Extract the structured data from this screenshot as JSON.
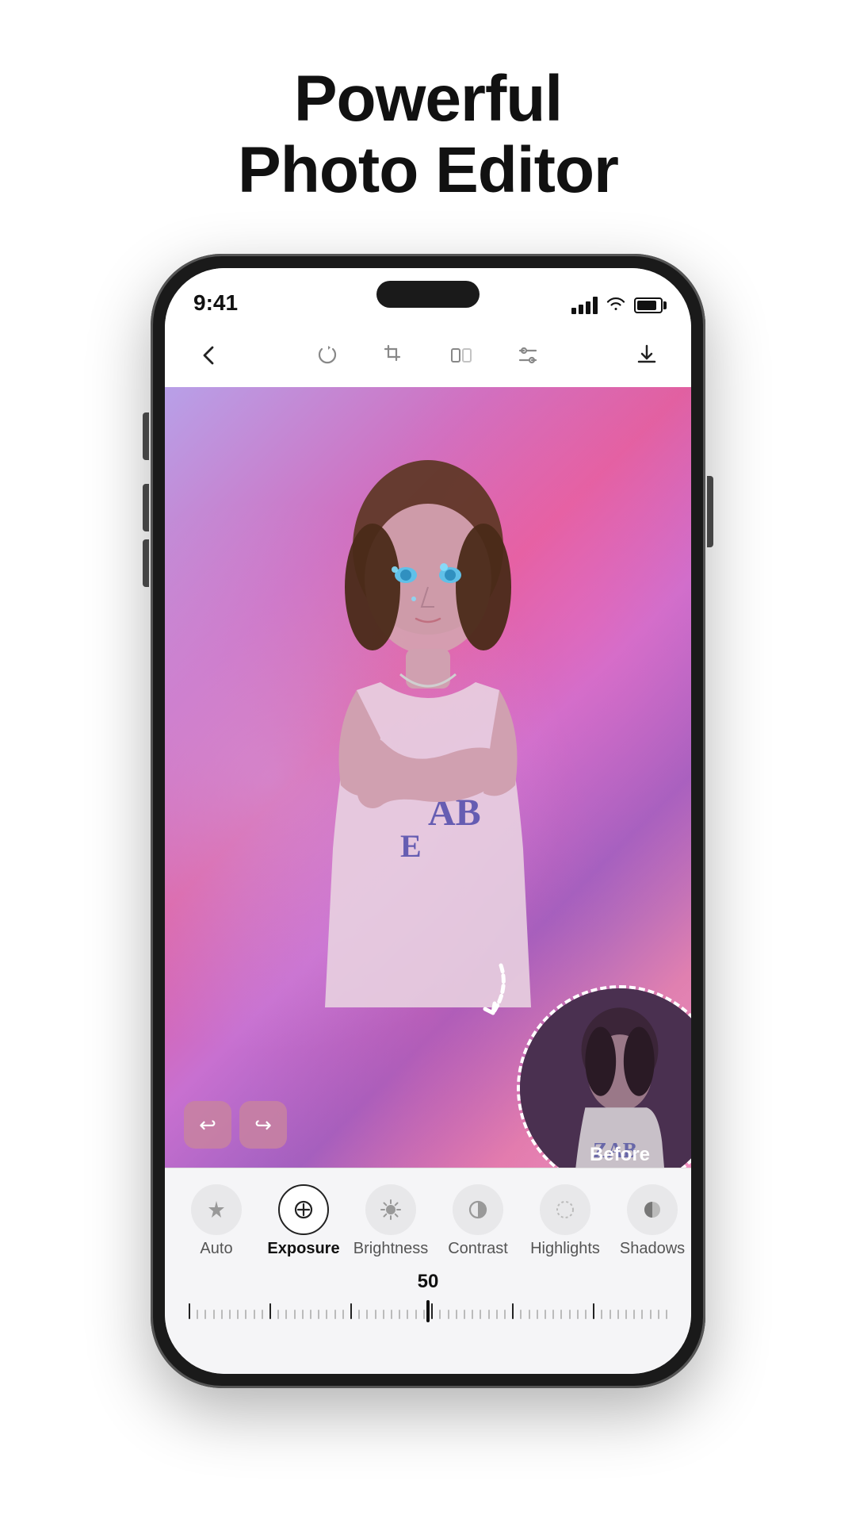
{
  "headline": {
    "line1": "Powerful",
    "line2": "Photo Editor"
  },
  "status_bar": {
    "time": "9:41"
  },
  "toolbar": {
    "back_label": "‹",
    "download_label": "↓"
  },
  "photo": {
    "before_label": "Before"
  },
  "editor": {
    "slider_value": "50",
    "tools": [
      {
        "id": "auto",
        "label": "Auto",
        "icon": "✦",
        "active": false
      },
      {
        "id": "exposure",
        "label": "Exposure",
        "icon": "⊕",
        "active": true
      },
      {
        "id": "brightness",
        "label": "Brightness",
        "icon": "☀",
        "active": false
      },
      {
        "id": "contrast",
        "label": "Contrast",
        "icon": "◑",
        "active": false
      },
      {
        "id": "highlights",
        "label": "Highlights",
        "icon": "◌",
        "active": false
      },
      {
        "id": "shadows",
        "label": "Shadows",
        "icon": "◗",
        "active": false
      }
    ]
  }
}
